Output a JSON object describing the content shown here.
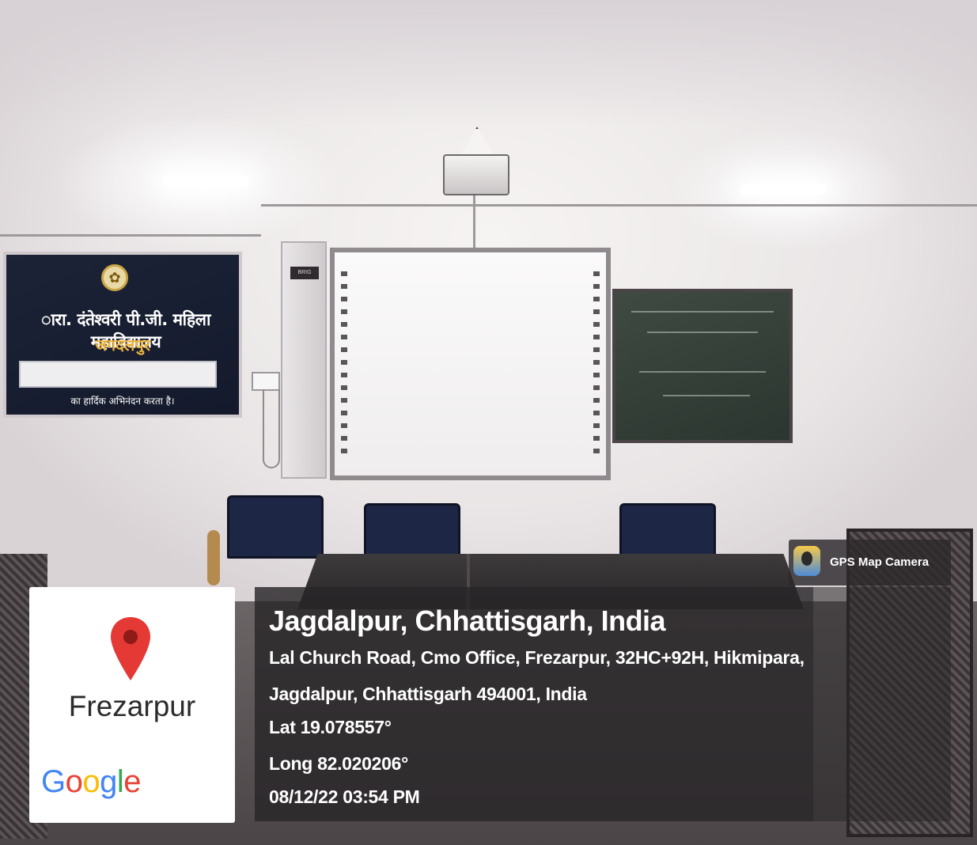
{
  "scene": {
    "banner": {
      "title": "ारा. दंतेश्वरी पी.जी. महिला महाविद्यालय",
      "subtitle": "जगदलपुर",
      "footer": "का हार्दिक अभिनंदन करता है।"
    },
    "cabinet_label": "BRIG"
  },
  "gps_badge": {
    "label": "GPS Map Camera"
  },
  "map_card": {
    "place": "Frezarpur",
    "google_logo": [
      "G",
      "o",
      "o",
      "g",
      "l",
      "e"
    ]
  },
  "location": {
    "title": "Jagdalpur, Chhattisgarh, India",
    "address_line1": "Lal Church Road, Cmo Office, Frezarpur, 32HC+92H, Hikmipara,",
    "address_line2": "Jagdalpur, Chhattisgarh 494001, India",
    "lat": "Lat 19.078557°",
    "long": "Long 82.020206°",
    "datetime": "08/12/22 03:54 PM"
  },
  "colors": {
    "overlay": "#2a282a",
    "pin": "#e53935",
    "banner_bg": "#1d2337",
    "banner_accent": "#f0b43a"
  }
}
